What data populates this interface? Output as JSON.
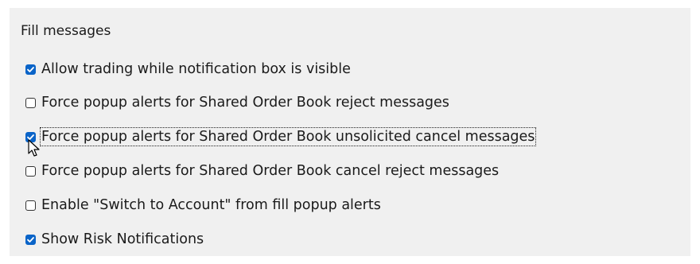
{
  "group": {
    "title": "Fill messages"
  },
  "options": [
    {
      "label": "Allow trading while notification box is visible",
      "checked": true
    },
    {
      "label": "Force popup alerts for Shared Order Book reject messages",
      "checked": false
    },
    {
      "label": "Force popup alerts for Shared Order Book unsolicited cancel messages",
      "checked": true,
      "focused": true
    },
    {
      "label": "Force popup alerts for Shared Order Book cancel reject messages",
      "checked": false
    },
    {
      "label": "Enable \"Switch to Account\" from fill popup alerts",
      "checked": false
    },
    {
      "label": "Show Risk Notifications",
      "checked": true
    }
  ],
  "cursor": {
    "icon": "mouse-pointer-arrow-icon"
  },
  "colors": {
    "panel_background": "#f0f0f0",
    "checkbox_accent": "#0a64c8",
    "text": "#1a1a1a"
  }
}
